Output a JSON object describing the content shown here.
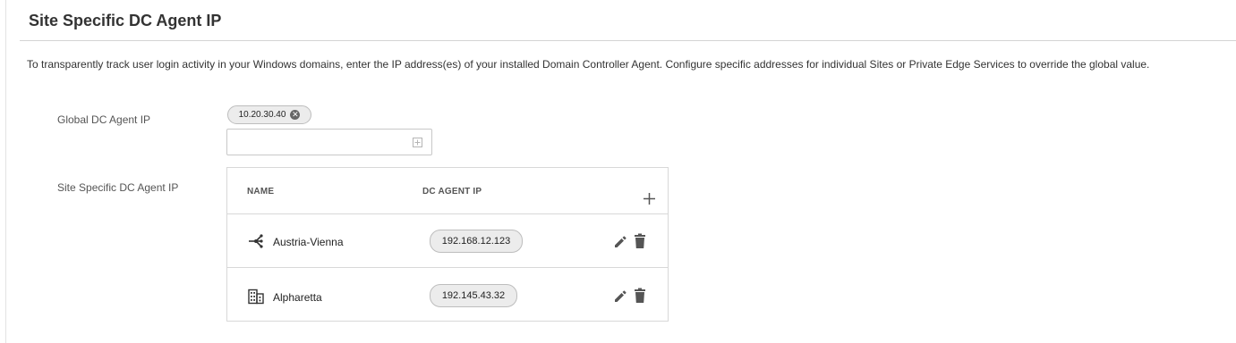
{
  "panel": {
    "title": "Site Specific DC Agent IP",
    "description": "To transparently track user login activity in your Windows domains, enter the IP address(es) of your installed Domain Controller Agent. Configure specific addresses for individual Sites or Private Edge Services to override the global value."
  },
  "global": {
    "label": "Global DC Agent IP",
    "ips": [
      "10.20.30.40"
    ],
    "input_value": "",
    "add_icon": "plus-square-icon"
  },
  "site_specific": {
    "label": "Site Specific DC Agent IP",
    "columns": {
      "name": "NAME",
      "ip": "DC AGENT IP"
    },
    "add_icon": "plus-icon",
    "rows": [
      {
        "name": "Austria-Vienna",
        "icon": "network-hub-icon",
        "ip": "192.168.12.123"
      },
      {
        "name": "Alpharetta",
        "icon": "building-icon",
        "ip": "192.145.43.32"
      }
    ]
  }
}
